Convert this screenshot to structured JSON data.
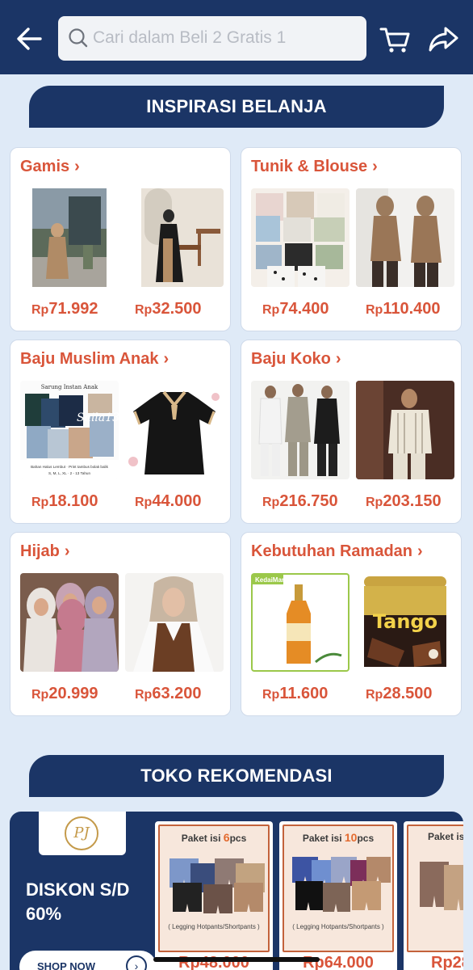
{
  "header": {
    "search_placeholder": "Cari dalam Beli 2 Gratis 1"
  },
  "inspirasi": {
    "title": "INSPIRASI BELANJA",
    "categories": [
      {
        "name": "Gamis",
        "prices": [
          "71.992",
          "32.500"
        ]
      },
      {
        "name": "Tunik & Blouse",
        "prices": [
          "74.400",
          "110.400"
        ]
      },
      {
        "name": "Baju Muslim Anak",
        "prices": [
          "18.100",
          "44.000"
        ]
      },
      {
        "name": "Baju Koko",
        "prices": [
          "216.750",
          "203.150"
        ]
      },
      {
        "name": "Hijab",
        "prices": [
          "20.999",
          "63.200"
        ]
      },
      {
        "name": "Kebutuhan Ramadan",
        "prices": [
          "11.600",
          "28.500"
        ]
      }
    ],
    "currency": "Rp",
    "image_labels": {
      "anak_line1": "Sarung Instan Anak",
      "anak_brand": "Saila13",
      "anak_caption": "Bahan Halus Lembut · Print tambus bolak balik",
      "anak_sizes": "S, M, L, XL · 2 - 13 Tahun",
      "kedaimart": "KedaiMart",
      "tango": "Tango"
    }
  },
  "toko": {
    "title": "TOKO REKOMENDASI",
    "logo_initials": "PJ",
    "promo_line1": "DISKON S/D",
    "promo_line2": "60%",
    "shop_now": "SHOP NOW",
    "products": [
      {
        "paket_prefix": "Paket isi ",
        "count": "6",
        "unit": "pcs",
        "label": "( Legging Hotpants/Shortpants )",
        "price": "Rp48.000"
      },
      {
        "paket_prefix": "Paket isi ",
        "count": "10",
        "unit": "pcs",
        "label": "( Legging Hotpants/Shortpants )",
        "price": "Rp64.000"
      },
      {
        "paket_prefix": "Paket isi",
        "count": "",
        "unit": "",
        "label": "",
        "price": "Rp28"
      }
    ]
  }
}
